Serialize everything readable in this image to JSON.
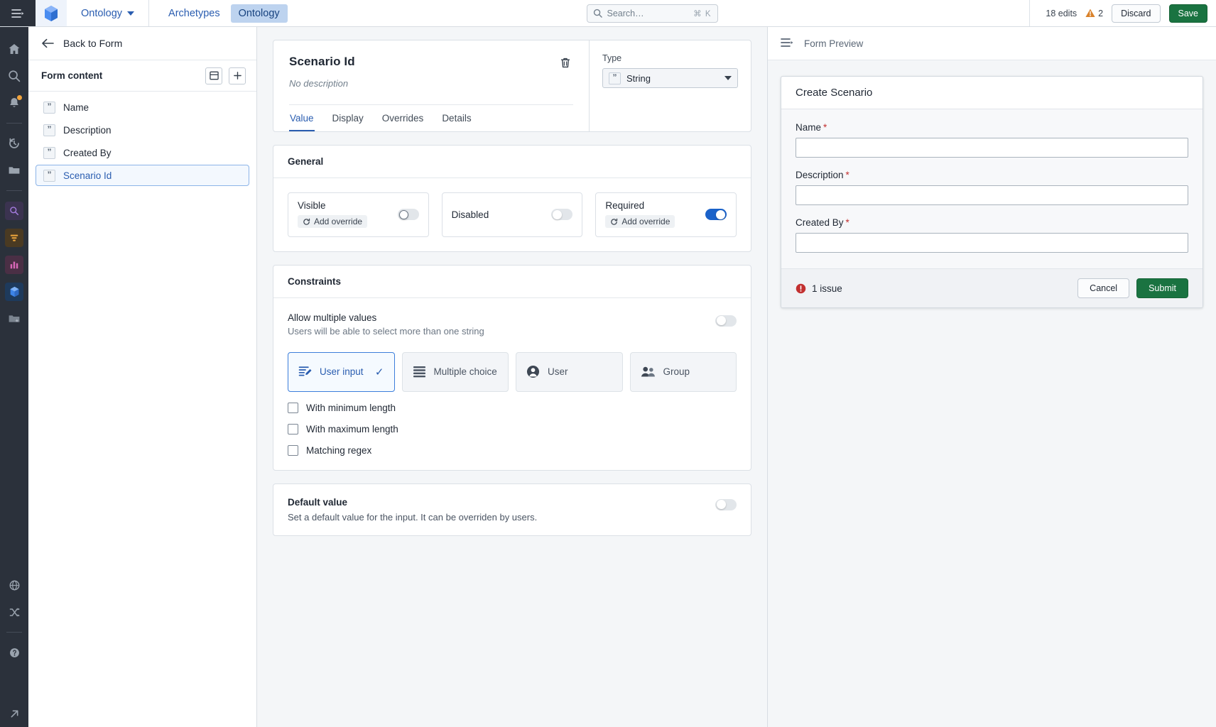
{
  "topbar": {
    "hamburger_icon": "menu-expand-icon",
    "logo_icon": "cube-logo-icon",
    "app_name": "Ontology",
    "nav_items": [
      {
        "label": "Archetypes",
        "active": false
      },
      {
        "label": "Ontology",
        "active": true
      }
    ],
    "search": {
      "placeholder": "Search…",
      "value": "",
      "shortcut": "⌘ K"
    },
    "edits_label": "18 edits",
    "warning_count": "2",
    "discard_label": "Discard",
    "save_label": "Save"
  },
  "rail": {
    "items": [
      {
        "name": "home-icon"
      },
      {
        "name": "search-icon"
      },
      {
        "name": "notifications-icon"
      },
      {
        "name": "history-icon"
      },
      {
        "name": "folder-icon"
      },
      {
        "name": "object-explorer-icon"
      },
      {
        "name": "pipeline-icon"
      },
      {
        "name": "charts-icon"
      },
      {
        "name": "ontology-manager-icon"
      },
      {
        "name": "starred-folder-icon"
      },
      {
        "name": "globe-icon"
      },
      {
        "name": "shuffle-icon"
      },
      {
        "name": "help-icon"
      },
      {
        "name": "external-link-icon"
      }
    ]
  },
  "left_panel": {
    "back_label": "Back to Form",
    "section_title": "Form content",
    "items": [
      {
        "label": "Name",
        "type_icon": "string-icon",
        "selected": false
      },
      {
        "label": "Description",
        "type_icon": "string-icon",
        "selected": false
      },
      {
        "label": "Created By",
        "type_icon": "string-icon",
        "selected": false
      },
      {
        "label": "Scenario Id",
        "type_icon": "string-icon",
        "selected": true
      }
    ]
  },
  "editor": {
    "title": "Scenario Id",
    "description": "No description",
    "tabs": [
      {
        "label": "Value",
        "active": true
      },
      {
        "label": "Display",
        "active": false
      },
      {
        "label": "Overrides",
        "active": false
      },
      {
        "label": "Details",
        "active": false
      }
    ],
    "type": {
      "label": "Type",
      "value": "String"
    },
    "general": {
      "heading": "General",
      "toggles": [
        {
          "label": "Visible",
          "override_label": "Add override",
          "has_override": true,
          "on": false,
          "hover": true
        },
        {
          "label": "Disabled",
          "override_label": "",
          "has_override": false,
          "on": false,
          "hover": false
        },
        {
          "label": "Required",
          "override_label": "Add override",
          "has_override": true,
          "on": true,
          "hover": false
        }
      ]
    },
    "constraints": {
      "heading": "Constraints",
      "allow_multiple_title": "Allow multiple values",
      "allow_multiple_sub": "Users will be able to select more than one string",
      "allow_multiple_on": false,
      "options": [
        {
          "label": "User input",
          "icon": "user-input-icon",
          "selected": true
        },
        {
          "label": "Multiple choice",
          "icon": "list-icon",
          "selected": false
        },
        {
          "label": "User",
          "icon": "user-icon",
          "selected": false
        },
        {
          "label": "Group",
          "icon": "group-icon",
          "selected": false
        }
      ],
      "checkboxes": [
        {
          "label": "With minimum length",
          "checked": false
        },
        {
          "label": "With maximum length",
          "checked": false
        },
        {
          "label": "Matching regex",
          "checked": false
        }
      ]
    },
    "default_value": {
      "title": "Default value",
      "sub": "Set a default value for the input. It can be overriden by users.",
      "on": false
    }
  },
  "preview": {
    "header": "Form Preview",
    "dialog_title": "Create Scenario",
    "fields": [
      {
        "label": "Name",
        "required": true,
        "value": ""
      },
      {
        "label": "Description",
        "required": true,
        "value": ""
      },
      {
        "label": "Created By",
        "required": true,
        "value": ""
      }
    ],
    "issue_text": "1 issue",
    "cancel_label": "Cancel",
    "submit_label": "Submit"
  },
  "colors": {
    "brand_blue": "#2a5db0",
    "accent_blue": "#1a62c9",
    "save_green": "#1a7341",
    "warning_orange": "#d9822b",
    "error_red": "#c23030",
    "rail_dark": "#2b313b"
  }
}
